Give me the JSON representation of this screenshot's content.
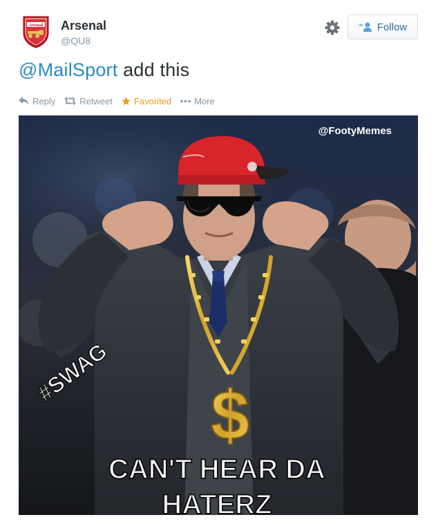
{
  "account": {
    "name": "Arsenal",
    "handle": "@QU8",
    "avatar_icon": "arsenal-crest-icon",
    "avatar_label": "Arsenal"
  },
  "header": {
    "settings_icon": "gear-icon",
    "follow_label": "Follow",
    "follow_icon": "add-user-icon"
  },
  "tweet": {
    "mention": "@MailSport",
    "text": " add this"
  },
  "actions": {
    "reply": "Reply",
    "retweet": "Retweet",
    "favorited": "Favorited",
    "more": "More"
  },
  "photo": {
    "watermark": "@FootyMemes",
    "hashtag": "#SWAG",
    "caption_line1": "CAN'T HEAR DA",
    "caption_line2": "HATERZ",
    "pendant": "$"
  },
  "colors": {
    "link": "#2a8bc6",
    "muted": "#8899a6",
    "favorite": "#f19a16",
    "follow_text": "#2f6fa4"
  }
}
